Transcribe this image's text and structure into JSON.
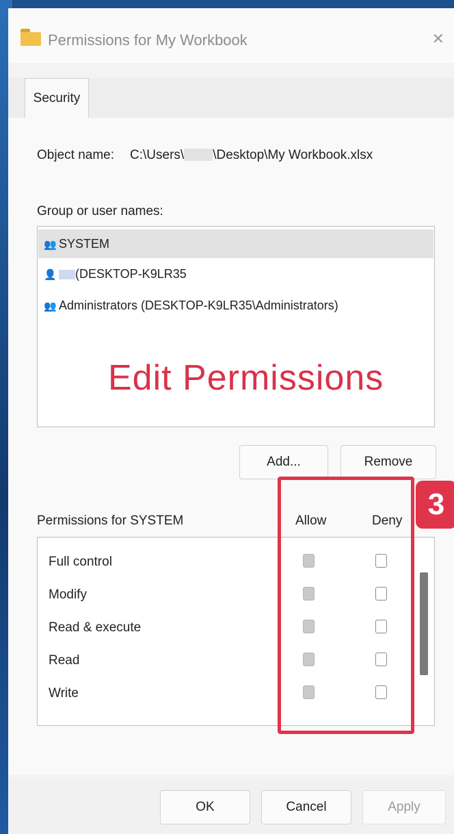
{
  "dialog": {
    "title": "Permissions for My Workbook",
    "close_icon": "close-icon",
    "tab": "Security"
  },
  "object": {
    "label": "Object name:",
    "path_prefix": "C:\\Users\\",
    "path_suffix": "\\Desktop\\My Workbook.xlsx"
  },
  "users": {
    "label": "Group or user names:",
    "items": [
      {
        "icon": "group-icon",
        "label": "SYSTEM",
        "selected": true
      },
      {
        "icon": "user-icon",
        "label": "(DESKTOP-K9LR35",
        "selected": false
      },
      {
        "icon": "group-icon",
        "label": "Administrators (DESKTOP-K9LR35\\Administrators)",
        "selected": false
      }
    ]
  },
  "annotation": {
    "overlay_text": "Edit Permissions",
    "step_number": "3",
    "color": "#e0344b"
  },
  "buttons": {
    "add": "Add...",
    "remove": "Remove",
    "ok": "OK",
    "cancel": "Cancel",
    "apply": "Apply"
  },
  "permissions": {
    "label": "Permissions for SYSTEM",
    "allow_header": "Allow",
    "deny_header": "Deny",
    "rows": [
      {
        "name": "Full control",
        "allow": true,
        "deny": false
      },
      {
        "name": "Modify",
        "allow": true,
        "deny": false
      },
      {
        "name": "Read & execute",
        "allow": true,
        "deny": false
      },
      {
        "name": "Read",
        "allow": true,
        "deny": false
      },
      {
        "name": "Write",
        "allow": true,
        "deny": false
      }
    ]
  }
}
